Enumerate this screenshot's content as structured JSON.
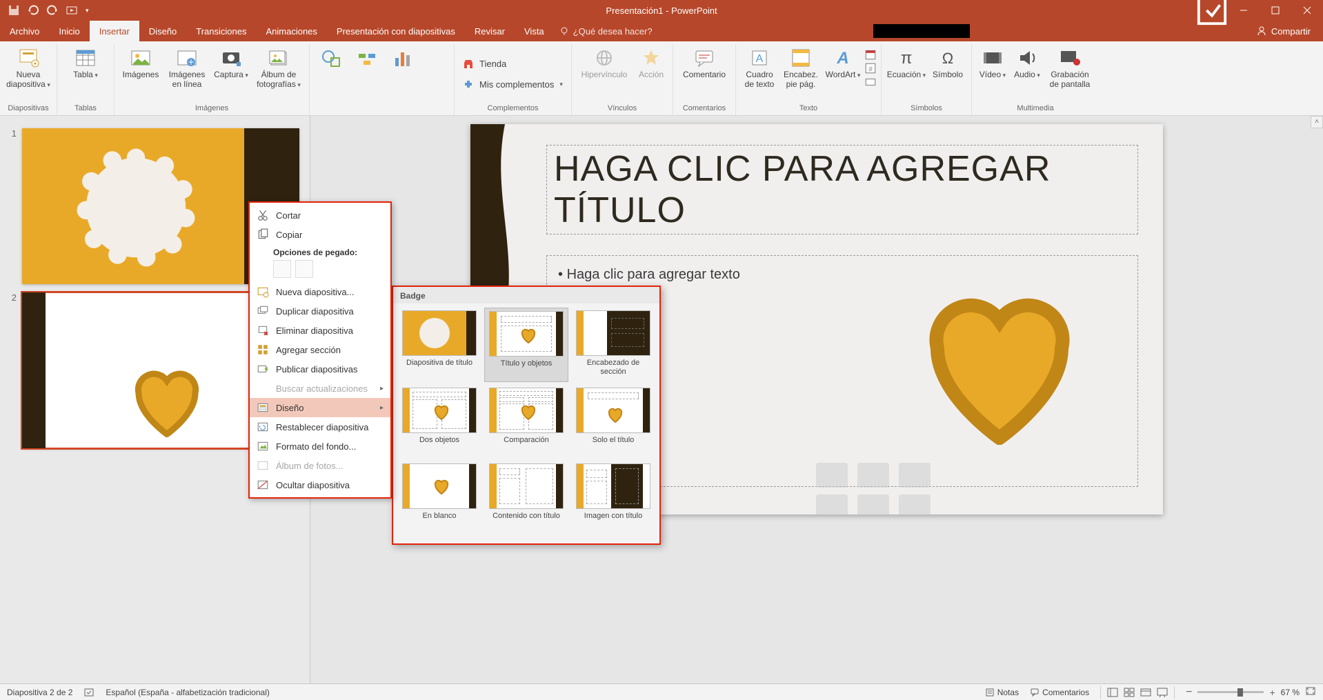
{
  "app_title": "Presentación1 - PowerPoint",
  "tabs": {
    "file": "Archivo",
    "home": "Inicio",
    "insert": "Insertar",
    "design": "Diseño",
    "transitions": "Transiciones",
    "animations": "Animaciones",
    "slideshow": "Presentación con diapositivas",
    "review": "Revisar",
    "view": "Vista"
  },
  "tell_me_placeholder": "¿Qué desea hacer?",
  "share": "Compartir",
  "ribbon": {
    "slides_group": "Diapositivas",
    "new_slide": "Nueva diapositiva",
    "tables_group": "Tablas",
    "table": "Tabla",
    "images_group": "Imágenes",
    "images": "Imágenes",
    "online_images": "Imágenes en línea",
    "screenshot": "Captura",
    "photo_album": "Álbum de fotografías",
    "links_group": "Vínculos",
    "hyperlink": "Hipervínculo",
    "action": "Acción",
    "comments_group": "Comentarios",
    "comment": "Comentario",
    "text_group": "Texto",
    "text_box": "Cuadro de texto",
    "header_footer": "Encabez. pie pág.",
    "wordart": "WordArt",
    "symbols_group": "Símbolos",
    "equation": "Ecuación",
    "symbol": "Símbolo",
    "media_group": "Multimedia",
    "video": "Vídeo",
    "audio": "Audio",
    "screen_recording": "Grabación de pantalla",
    "addins_group": "Complementos",
    "store": "Tienda",
    "my_addins": "Mis complementos"
  },
  "slides": {
    "num1": "1",
    "num2": "2"
  },
  "canvas": {
    "title_placeholder": "HAGA CLIC PARA AGREGAR TÍTULO",
    "body_placeholder": "Haga clic para agregar texto"
  },
  "context_menu": {
    "cut": "Cortar",
    "copy": "Copiar",
    "paste_options": "Opciones de pegado:",
    "new_slide": "Nueva diapositiva...",
    "duplicate_slide": "Duplicar diapositiva",
    "delete_slide": "Eliminar diapositiva",
    "add_section": "Agregar sección",
    "publish_slides": "Publicar diapositivas",
    "check_updates": "Buscar actualizaciones",
    "layout": "Diseño",
    "reset_slide": "Restablecer diapositiva",
    "format_background": "Formato del fondo...",
    "photo_album": "Álbum de fotos...",
    "hide_slide": "Ocultar diapositiva"
  },
  "layout_gallery": {
    "title": "Badge",
    "items": [
      "Diapositiva de título",
      "Título y objetos",
      "Encabezado de sección",
      "Dos objetos",
      "Comparación",
      "Solo el título",
      "En blanco",
      "Contenido con título",
      "Imagen con título"
    ]
  },
  "status": {
    "slide_info": "Diapositiva 2 de 2",
    "language": "Español (España - alfabetización tradicional)",
    "notes": "Notas",
    "comments": "Comentarios",
    "zoom": "67 %"
  },
  "colors": {
    "brand": "#b7472a",
    "accent_gold": "#e9a928",
    "dark": "#2f230f"
  }
}
